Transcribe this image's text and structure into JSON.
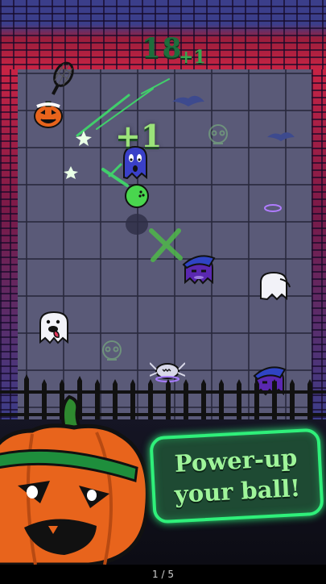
{
  "hud": {
    "score": "18",
    "score_bonus": "+1",
    "hit_bonus": "+1"
  },
  "promo": {
    "line1": "Power-up",
    "line2": "your ball!"
  },
  "pager": {
    "label": "1 / 5"
  },
  "colors": {
    "neon_green": "#2ff07a",
    "pumpkin_orange": "#e8641c",
    "wall_red": "#c82344",
    "wall_blue": "#3b3e8a",
    "floor": "#5a5a78"
  },
  "sprites": {
    "ball": "green-ball",
    "player": "jack-o-lantern-with-racket",
    "enemies": [
      "blue-ghost",
      "purple-witch-ghost",
      "white-ghost",
      "white-ghost-tongue",
      "purple-witch-ghost",
      "silver-spider"
    ]
  }
}
